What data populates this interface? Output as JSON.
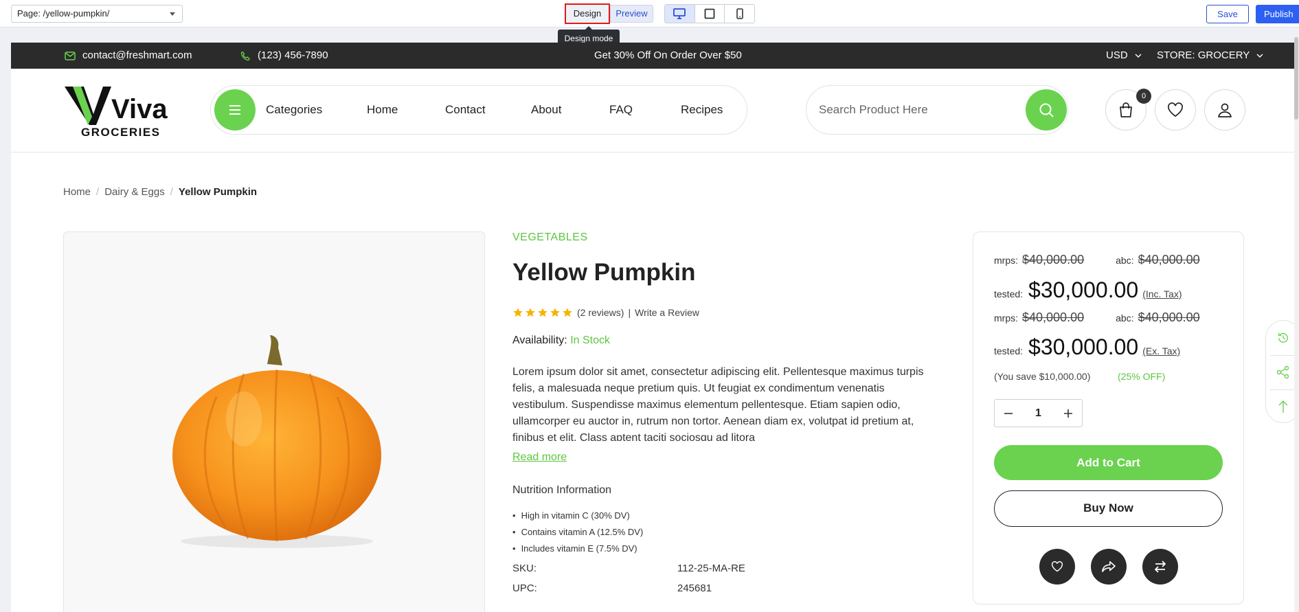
{
  "editor": {
    "page_select": "Page: /yellow-pumpkin/",
    "design_label": "Design",
    "preview_label": "Preview",
    "tooltip": "Design mode",
    "save_label": "Save",
    "publish_label": "Publish"
  },
  "topbar": {
    "email": "contact@freshmart.com",
    "phone": "(123) 456-7890",
    "promo": "Get 30% Off On Order Over $50",
    "currency": "USD",
    "store": "STORE: GROCERY"
  },
  "logo": {
    "brand": "Viva",
    "tagline": "GROCERIES"
  },
  "nav": {
    "categories": "Categories",
    "home": "Home",
    "contact": "Contact",
    "about": "About",
    "faq": "FAQ",
    "recipes": "Recipes"
  },
  "search": {
    "placeholder": "Search Product Here"
  },
  "cart": {
    "count": "0"
  },
  "breadcrumb": {
    "home": "Home",
    "category": "Dairy & Eggs",
    "current": "Yellow Pumpkin"
  },
  "product": {
    "category": "VEGETABLES",
    "title": "Yellow Pumpkin",
    "rating": 5,
    "reviews": "(2 reviews)",
    "review_sep": "|",
    "write_review": "Write a Review",
    "availability_label": "Availability:",
    "availability_value": "In Stock",
    "description": "Lorem ipsum dolor sit amet, consectetur adipiscing elit. Pellentesque maximus turpis felis, a malesuada neque pretium quis. Ut feugiat ex condimentum venenatis vestibulum. Suspendisse maximus elementum pellentesque. Etiam sapien odio, ullamcorper eu auctor in, rutrum non tortor. Aenean diam ex, volutpat id pretium at, finibus et elit. Class aptent taciti sociosqu ad litora",
    "read_more": "Read more",
    "nutrition_title": "Nutrition Information",
    "nutrition": [
      "High in vitamin C (30% DV)",
      "Contains vitamin A (12.5% DV)",
      "Includes vitamin E (7.5% DV)"
    ],
    "sku_label": "SKU:",
    "sku_value": "112-25-MA-RE",
    "upc_label": "UPC:",
    "upc_value": "245681"
  },
  "pricing": {
    "mrps_label": "mrps:",
    "mrps_value": "$40,000.00",
    "abc_label": "abc:",
    "abc_value": "$40,000.00",
    "tested_label": "tested:",
    "tested_value": "$30,000.00",
    "inc_tax": "(Inc. Tax)",
    "ex_tax": "(Ex. Tax)",
    "save_note": "(You save $10,000.00)",
    "save_off": "(25% OFF)",
    "quantity": "1",
    "add_to_cart": "Add to Cart",
    "buy_now": "Buy Now"
  },
  "colors": {
    "brand_green": "#6ad24f",
    "dark": "#2b2b2b",
    "editor_blue": "#2c5ff2",
    "highlight_red": "#e21a1a"
  }
}
